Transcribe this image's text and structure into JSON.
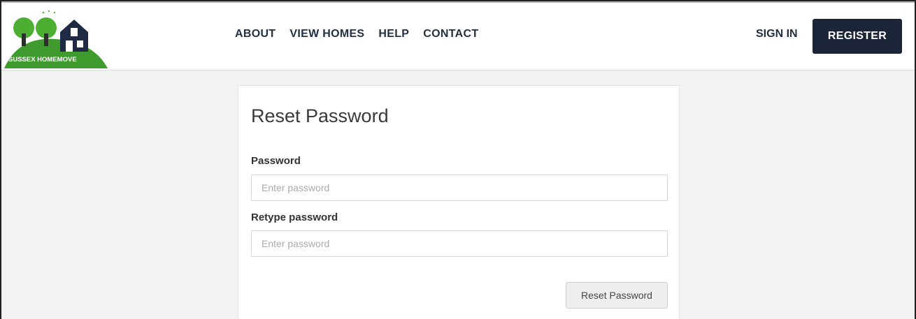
{
  "brand": {
    "logo_text": "SUSSEX HOMEMOVE",
    "colors": {
      "hill": "#3f9b2e",
      "tree": "#4caf32",
      "house": "#1f2a44"
    }
  },
  "nav": {
    "links": [
      {
        "label": "ABOUT"
      },
      {
        "label": "VIEW HOMES"
      },
      {
        "label": "HELP"
      },
      {
        "label": "CONTACT"
      }
    ],
    "sign_in": "SIGN IN",
    "register": "REGISTER"
  },
  "form": {
    "title": "Reset Password",
    "password_label": "Password",
    "password_placeholder": "Enter password",
    "password_value": "",
    "retype_label": "Retype password",
    "retype_placeholder": "Enter password",
    "retype_value": "",
    "submit_label": "Reset Password"
  },
  "colors": {
    "nav_text": "#243042",
    "register_bg": "#1c2538",
    "page_bg": "#f2f2f2"
  }
}
